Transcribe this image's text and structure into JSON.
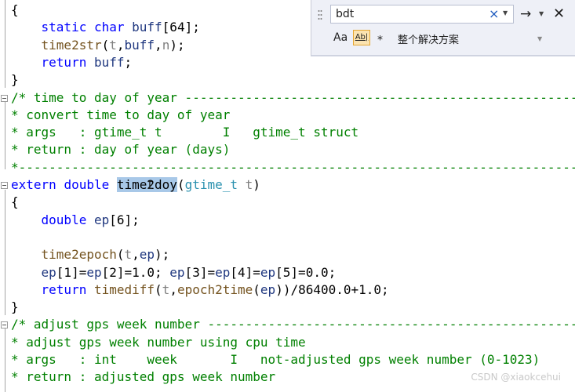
{
  "editor": {
    "lines": [
      [
        [
          "t",
          "{"
        ]
      ],
      [
        [
          "t",
          "    "
        ],
        [
          "kw",
          "static"
        ],
        [
          "t",
          " "
        ],
        [
          "kw",
          "char"
        ],
        [
          "t",
          " "
        ],
        [
          "va",
          "buff"
        ],
        [
          "t",
          "[64];"
        ]
      ],
      [
        [
          "t",
          "    "
        ],
        [
          "fn",
          "time2str"
        ],
        [
          "t",
          "("
        ],
        [
          "pa",
          "t"
        ],
        [
          "t",
          ","
        ],
        [
          "va",
          "buff"
        ],
        [
          "t",
          ","
        ],
        [
          "pa",
          "n"
        ],
        [
          "t",
          ");"
        ]
      ],
      [
        [
          "t",
          "    "
        ],
        [
          "kw",
          "return"
        ],
        [
          "t",
          " "
        ],
        [
          "va",
          "buff"
        ],
        [
          "t",
          ";"
        ]
      ],
      [
        [
          "t",
          "}"
        ]
      ],
      [
        [
          "cm",
          "/* time to day of year -------------------------------------------------------"
        ]
      ],
      [
        [
          "cm",
          "* convert time to day of year"
        ]
      ],
      [
        [
          "cm",
          "* args   : gtime_t t        I   gtime_t struct"
        ]
      ],
      [
        [
          "cm",
          "* return : day of year (days)"
        ]
      ],
      [
        [
          "cm",
          "*-----------------------------------------------------------------------------"
        ]
      ],
      [
        [
          "kw",
          "extern"
        ],
        [
          "t",
          " "
        ],
        [
          "kw",
          "double"
        ],
        [
          "t",
          " "
        ],
        [
          "hl",
          "time2doy"
        ],
        [
          "t",
          "("
        ],
        [
          "ty",
          "gtime_t"
        ],
        [
          "t",
          " "
        ],
        [
          "pa",
          "t"
        ],
        [
          "t",
          ")"
        ]
      ],
      [
        [
          "t",
          "{"
        ]
      ],
      [
        [
          "t",
          "    "
        ],
        [
          "kw",
          "double"
        ],
        [
          "t",
          " "
        ],
        [
          "va",
          "ep"
        ],
        [
          "t",
          "[6];"
        ]
      ],
      [
        [
          "t",
          ""
        ]
      ],
      [
        [
          "t",
          "    "
        ],
        [
          "fn",
          "time2epoch"
        ],
        [
          "t",
          "("
        ],
        [
          "pa",
          "t"
        ],
        [
          "t",
          ","
        ],
        [
          "va",
          "ep"
        ],
        [
          "t",
          ");"
        ]
      ],
      [
        [
          "t",
          "    "
        ],
        [
          "va",
          "ep"
        ],
        [
          "t",
          "[1]="
        ],
        [
          "va",
          "ep"
        ],
        [
          "t",
          "[2]=1.0; "
        ],
        [
          "va",
          "ep"
        ],
        [
          "t",
          "[3]="
        ],
        [
          "va",
          "ep"
        ],
        [
          "t",
          "[4]="
        ],
        [
          "va",
          "ep"
        ],
        [
          "t",
          "[5]=0.0;"
        ]
      ],
      [
        [
          "t",
          "    "
        ],
        [
          "kw",
          "return"
        ],
        [
          "t",
          " "
        ],
        [
          "fn",
          "timediff"
        ],
        [
          "t",
          "("
        ],
        [
          "pa",
          "t"
        ],
        [
          "t",
          ","
        ],
        [
          "fn",
          "epoch2time"
        ],
        [
          "t",
          "("
        ],
        [
          "va",
          "ep"
        ],
        [
          "t",
          "))/86400.0+1.0;"
        ]
      ],
      [
        [
          "t",
          "}"
        ]
      ],
      [
        [
          "cm",
          "/* adjust gps week number ----------------------------------------------------"
        ]
      ],
      [
        [
          "cm",
          "* adjust gps week number using cpu time"
        ]
      ],
      [
        [
          "cm",
          "* args   : int    week       I   not-adjusted gps week number (0-1023)"
        ]
      ],
      [
        [
          "cm",
          "* return : adjusted gps week number"
        ]
      ]
    ]
  },
  "find": {
    "query": "bdt",
    "clear_icon": "×",
    "next_icon": "→",
    "close_icon": "✕",
    "match_case_label": "Aa",
    "whole_word_label": "Ab|",
    "regex_label": "⁎",
    "scope": "整个解决方案"
  },
  "watermark": "CSDN @xiaokcehui"
}
